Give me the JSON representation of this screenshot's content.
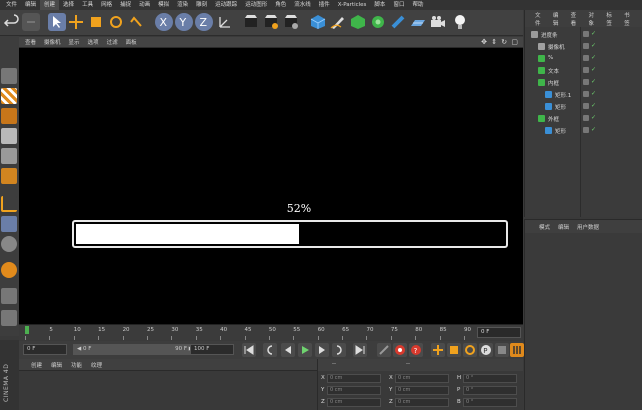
{
  "menubar": {
    "items": [
      "文件",
      "编辑",
      "创建",
      "选择",
      "工具",
      "网格",
      "捕捉",
      "动画",
      "模拟",
      "渲染",
      "雕刻",
      "运动跟踪",
      "运动图形",
      "角色",
      "流水线",
      "插件",
      "X-Particles",
      "脚本",
      "窗口",
      "帮助"
    ],
    "active_index": 2
  },
  "viewport": {
    "menu": [
      "查看",
      "摄像机",
      "显示",
      "选项",
      "过滤",
      "面板"
    ],
    "nav_icons": "✥ ⇕ ↻ ▢"
  },
  "progress": {
    "label": "52%",
    "value": 0.52
  },
  "timeline": {
    "ticks": [
      "0",
      "5",
      "10",
      "15",
      "20",
      "25",
      "30",
      "35",
      "40",
      "45",
      "50",
      "55",
      "60",
      "65",
      "70",
      "75",
      "80",
      "85",
      "90"
    ],
    "current_frame": "0 F"
  },
  "transport": {
    "start_field": "0 F",
    "range_start": "◀ 0 F",
    "range_end": "90 F ▶",
    "end_field": "100 F"
  },
  "material": {
    "menu": [
      "创建",
      "编辑",
      "功能",
      "纹理"
    ]
  },
  "coords": {
    "header": "--",
    "header2": "--",
    "rows": [
      {
        "a": "X",
        "av": "0 cm",
        "b": "X",
        "bv": "0 cm",
        "c": "H",
        "cv": "0 °"
      },
      {
        "a": "Y",
        "av": "0 cm",
        "b": "Y",
        "bv": "0 cm",
        "c": "P",
        "cv": "0 °"
      },
      {
        "a": "Z",
        "av": "0 cm",
        "b": "Z",
        "bv": "0 cm",
        "c": "B",
        "cv": "0 °"
      }
    ]
  },
  "brand": "CINEMA 4D",
  "object_manager": {
    "menu": [
      "文件",
      "编辑",
      "查看",
      "对象",
      "标签",
      "书签"
    ],
    "objects": [
      {
        "name": "进度条",
        "indent": 0,
        "color": "#9a9a9a"
      },
      {
        "name": "摄像机",
        "indent": 1,
        "color": "#a0a0a0"
      },
      {
        "name": "%",
        "indent": 1,
        "color": "#3fb54a"
      },
      {
        "name": "文本",
        "indent": 1,
        "color": "#3fb54a"
      },
      {
        "name": "内框",
        "indent": 1,
        "color": "#3fb54a"
      },
      {
        "name": "矩形.1",
        "indent": 2,
        "color": "#3a8fd6"
      },
      {
        "name": "矩形",
        "indent": 2,
        "color": "#3a8fd6"
      },
      {
        "name": "外框",
        "indent": 1,
        "color": "#3fb54a"
      },
      {
        "name": "矩形",
        "indent": 2,
        "color": "#3a8fd6"
      }
    ]
  },
  "attributes": {
    "menu": [
      "模式",
      "编辑",
      "用户数据"
    ]
  },
  "colors": {
    "accent_orange": "#f0a21e",
    "accent_blue": "#3a8fd6"
  }
}
